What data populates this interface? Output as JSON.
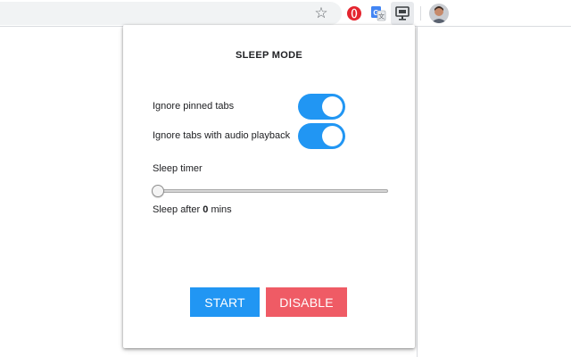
{
  "browser": {
    "toolbar_icons": {
      "bookmark": "star-outline-icon",
      "extension_1": "opera-vpn-icon",
      "extension_2": "google-translate-icon",
      "extension_3": "sleep-mode-extension-icon",
      "profile": "profile-avatar"
    }
  },
  "popup": {
    "title": "SLEEP MODE",
    "options": [
      {
        "label": "Ignore pinned tabs",
        "enabled": true
      },
      {
        "label": "Ignore tabs with audio playback",
        "enabled": true
      }
    ],
    "timer": {
      "label": "Sleep timer",
      "value": 0,
      "prefix": "Sleep after",
      "value_text": "0",
      "suffix": "mins"
    },
    "buttons": {
      "start": "START",
      "disable": "DISABLE"
    }
  },
  "colors": {
    "accent_blue": "#2196f3",
    "disable_red": "#ef5b65",
    "toggle_knob": "#ffffff"
  }
}
